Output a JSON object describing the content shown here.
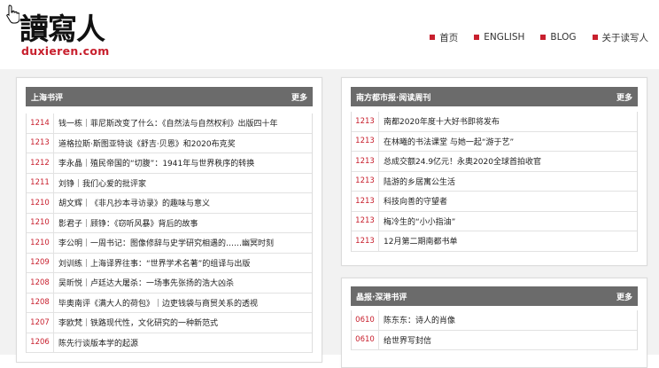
{
  "logo": {
    "text": "讀寫人",
    "url": "duxieren.com"
  },
  "nav": [
    {
      "label": "首页"
    },
    {
      "label": "ENGLISH"
    },
    {
      "label": "BLOG"
    },
    {
      "label": "关于读写人"
    }
  ],
  "left_panel": {
    "title": "上海书评",
    "more": "更多",
    "items": [
      {
        "date": "1214",
        "title": "钱一栋｜菲尼斯改变了什么：《自然法与自然权利》出版四十年"
      },
      {
        "date": "1213",
        "title": "道格拉斯·斯图亚特谈《舒吉·贝恩》和2020布克奖"
      },
      {
        "date": "1212",
        "title": "李永晶｜殖民帝国的“切腹”：1941年与世界秩序的转换"
      },
      {
        "date": "1211",
        "title": "刘铮｜我们心爱的批评家"
      },
      {
        "date": "1210",
        "title": "胡文辉｜《非凡抄本寻访录》的趣味与意义"
      },
      {
        "date": "1210",
        "title": "影君子｜顾铮：《窃听风暴》背后的故事"
      },
      {
        "date": "1210",
        "title": "李公明｜一周书记：图像修辞与史学研究相遇的……幽冥时刻"
      },
      {
        "date": "1209",
        "title": "刘训练｜上海译界往事：“世界学术名著”的组译与出版"
      },
      {
        "date": "1208",
        "title": "吴昕悦｜卢廷达大屠杀：一场事先张扬的浩大凶杀"
      },
      {
        "date": "1208",
        "title": "毕奥南评《满大人的荷包》｜边吏钱袋与商贸关系的透视"
      },
      {
        "date": "1207",
        "title": "李欧梵｜铁路现代性，文化研究的一种新范式"
      },
      {
        "date": "1206",
        "title": "陈先行谈版本学的起源"
      }
    ]
  },
  "right_top_panel": {
    "title": "南方都市报·阅读周刊",
    "more": "更多",
    "items": [
      {
        "date": "1213",
        "title": "南都2020年度十大好书即将发布"
      },
      {
        "date": "1213",
        "title": "在林曦的书法课堂 与她一起“游于艺”"
      },
      {
        "date": "1213",
        "title": "总成交额24.9亿元！永奥2020全球首拍收官"
      },
      {
        "date": "1213",
        "title": "陆游的乡居寓公生活"
      },
      {
        "date": "1213",
        "title": "科技向善的守望者"
      },
      {
        "date": "1213",
        "title": "梅冷生的“小小指油”"
      },
      {
        "date": "1213",
        "title": "12月第二期南都书单"
      }
    ]
  },
  "right_bottom_panel": {
    "title": "晶报·深港书评",
    "more": "更多",
    "items": [
      {
        "date": "0610",
        "title": "陈东东：诗人的肖像"
      },
      {
        "date": "0610",
        "title": "给世界写封信"
      }
    ]
  }
}
